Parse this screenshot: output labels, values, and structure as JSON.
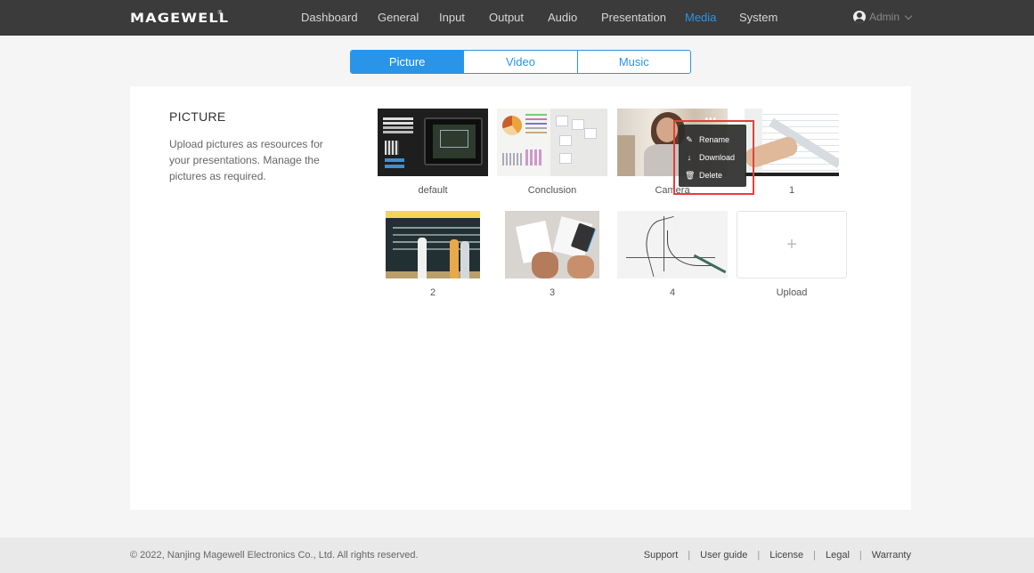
{
  "brand": {
    "logo": "MAGEWELL",
    "reg": "®"
  },
  "nav": {
    "items": [
      {
        "label": "Dashboard",
        "active": false
      },
      {
        "label": "General",
        "active": false
      },
      {
        "label": "Input",
        "active": false
      },
      {
        "label": "Output",
        "active": false
      },
      {
        "label": "Audio",
        "active": false
      },
      {
        "label": "Presentation",
        "active": false
      },
      {
        "label": "Media",
        "active": true
      },
      {
        "label": "System",
        "active": false
      }
    ],
    "user": "Admin",
    "active_color": "#2a95e8"
  },
  "tabs": [
    {
      "label": "Picture",
      "active": true
    },
    {
      "label": "Video",
      "active": false
    },
    {
      "label": "Music",
      "active": false
    }
  ],
  "section": {
    "title": "PICTURE",
    "description": "Upload pictures as resources for your presentations. Manage the pictures as required."
  },
  "pictures": [
    {
      "label": "default"
    },
    {
      "label": "Conclusion"
    },
    {
      "label": "Camera"
    },
    {
      "label": "1"
    },
    {
      "label": "2"
    },
    {
      "label": "3"
    },
    {
      "label": "4"
    }
  ],
  "upload": {
    "label": "Upload",
    "icon": "plus-icon"
  },
  "context_menu": {
    "items": [
      {
        "label": "Rename",
        "icon": "edit-icon"
      },
      {
        "label": "Download",
        "icon": "download-icon"
      },
      {
        "label": "Delete",
        "icon": "trash-icon"
      }
    ]
  },
  "footer": {
    "copyright": "© 2022, Nanjing Magewell Electronics Co., Ltd. All rights reserved.",
    "links": [
      "Support",
      "User guide",
      "License",
      "Legal",
      "Warranty"
    ]
  }
}
